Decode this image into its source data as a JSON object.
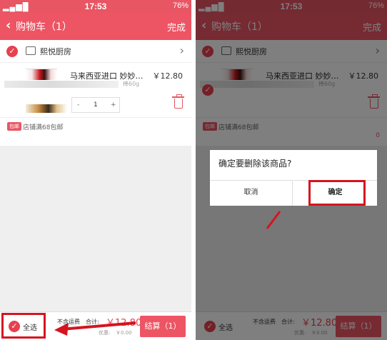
{
  "status": {
    "signal": "▂▄▆█",
    "time": "17:53",
    "battery": "76%"
  },
  "header": {
    "back_glyph": "‹",
    "title": "购物车（1）",
    "done_label": "完成"
  },
  "shop": {
    "name": "熙悦厨房"
  },
  "item": {
    "name": "马来西亚进口 妙妙…",
    "price": "￥12.80",
    "spec": "棒60g",
    "qty_minus": "-",
    "qty_value": "1",
    "qty_plus": "+"
  },
  "promo": {
    "badge": "包邮",
    "text": "店铺满68包邮",
    "zero": "0"
  },
  "footer": {
    "select_all": "全选",
    "shipping": "不含运费",
    "total_label": "合计:",
    "total_value": "￥12.80",
    "discount_label": "优惠:",
    "discount_value": "￥0.00",
    "checkout_label": "结算（1）"
  },
  "dialog": {
    "question": "确定要删除该商品?",
    "cancel_label": "取消",
    "confirm_label": "确定"
  },
  "colors": {
    "accent": "#ed5564",
    "annotation_red": "#d5141f"
  }
}
